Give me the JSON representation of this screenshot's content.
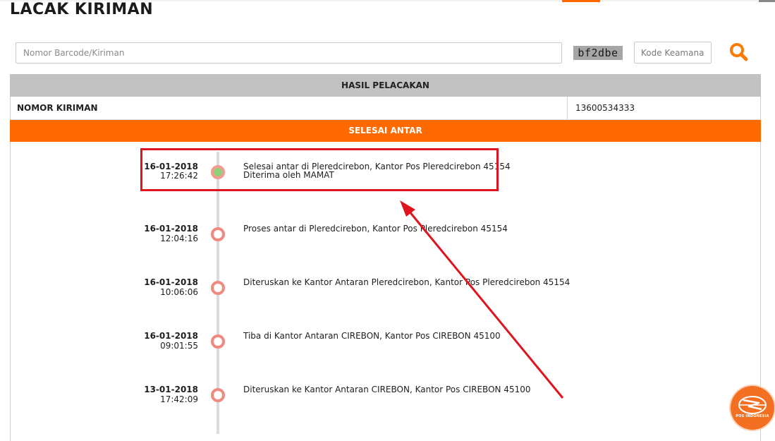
{
  "page": {
    "title": "LACAK KIRIMAN"
  },
  "search": {
    "barcode_placeholder": "Nomor Barcode/Kiriman",
    "captcha_text": "bf2dbe",
    "security_placeholder": "Kode Keamanan",
    "search_icon": "search-icon"
  },
  "results": {
    "header": "HASIL PELACAKAN",
    "shipment_label": "NOMOR KIRIMAN",
    "shipment_number": "13600534333",
    "status": "SELESAI ANTAR",
    "events": [
      {
        "date": "16-01-2018",
        "time": "17:26:42",
        "description": "Selesai antar di Pleredcirebon, Kantor Pos Pleredcirebon 45154",
        "note": "Diterima oleh MAMAT",
        "state": "done"
      },
      {
        "date": "16-01-2018",
        "time": "12:04:16",
        "description": "Proses antar di Pleredcirebon, Kantor Pos Pleredcirebon 45154"
      },
      {
        "date": "16-01-2018",
        "time": "10:06:06",
        "description": "Diteruskan ke Kantor Antaran Pleredcirebon, Kantor Pos Pleredcirebon 45154"
      },
      {
        "date": "16-01-2018",
        "time": "09:01:55",
        "description": "Tiba di Kantor Antaran CIREBON, Kantor Pos CIREBON 45100"
      },
      {
        "date": "13-01-2018",
        "time": "17:42:09",
        "description": "Diteruskan ke Kantor Antaran CIREBON, Kantor Pos CIREBON 45100"
      }
    ]
  },
  "branding": {
    "logo_text": "POS INDONESIA",
    "accent_color": "#ff6a00",
    "header_gray": "#c2c2c2",
    "annotation_color": "#e0141e"
  }
}
